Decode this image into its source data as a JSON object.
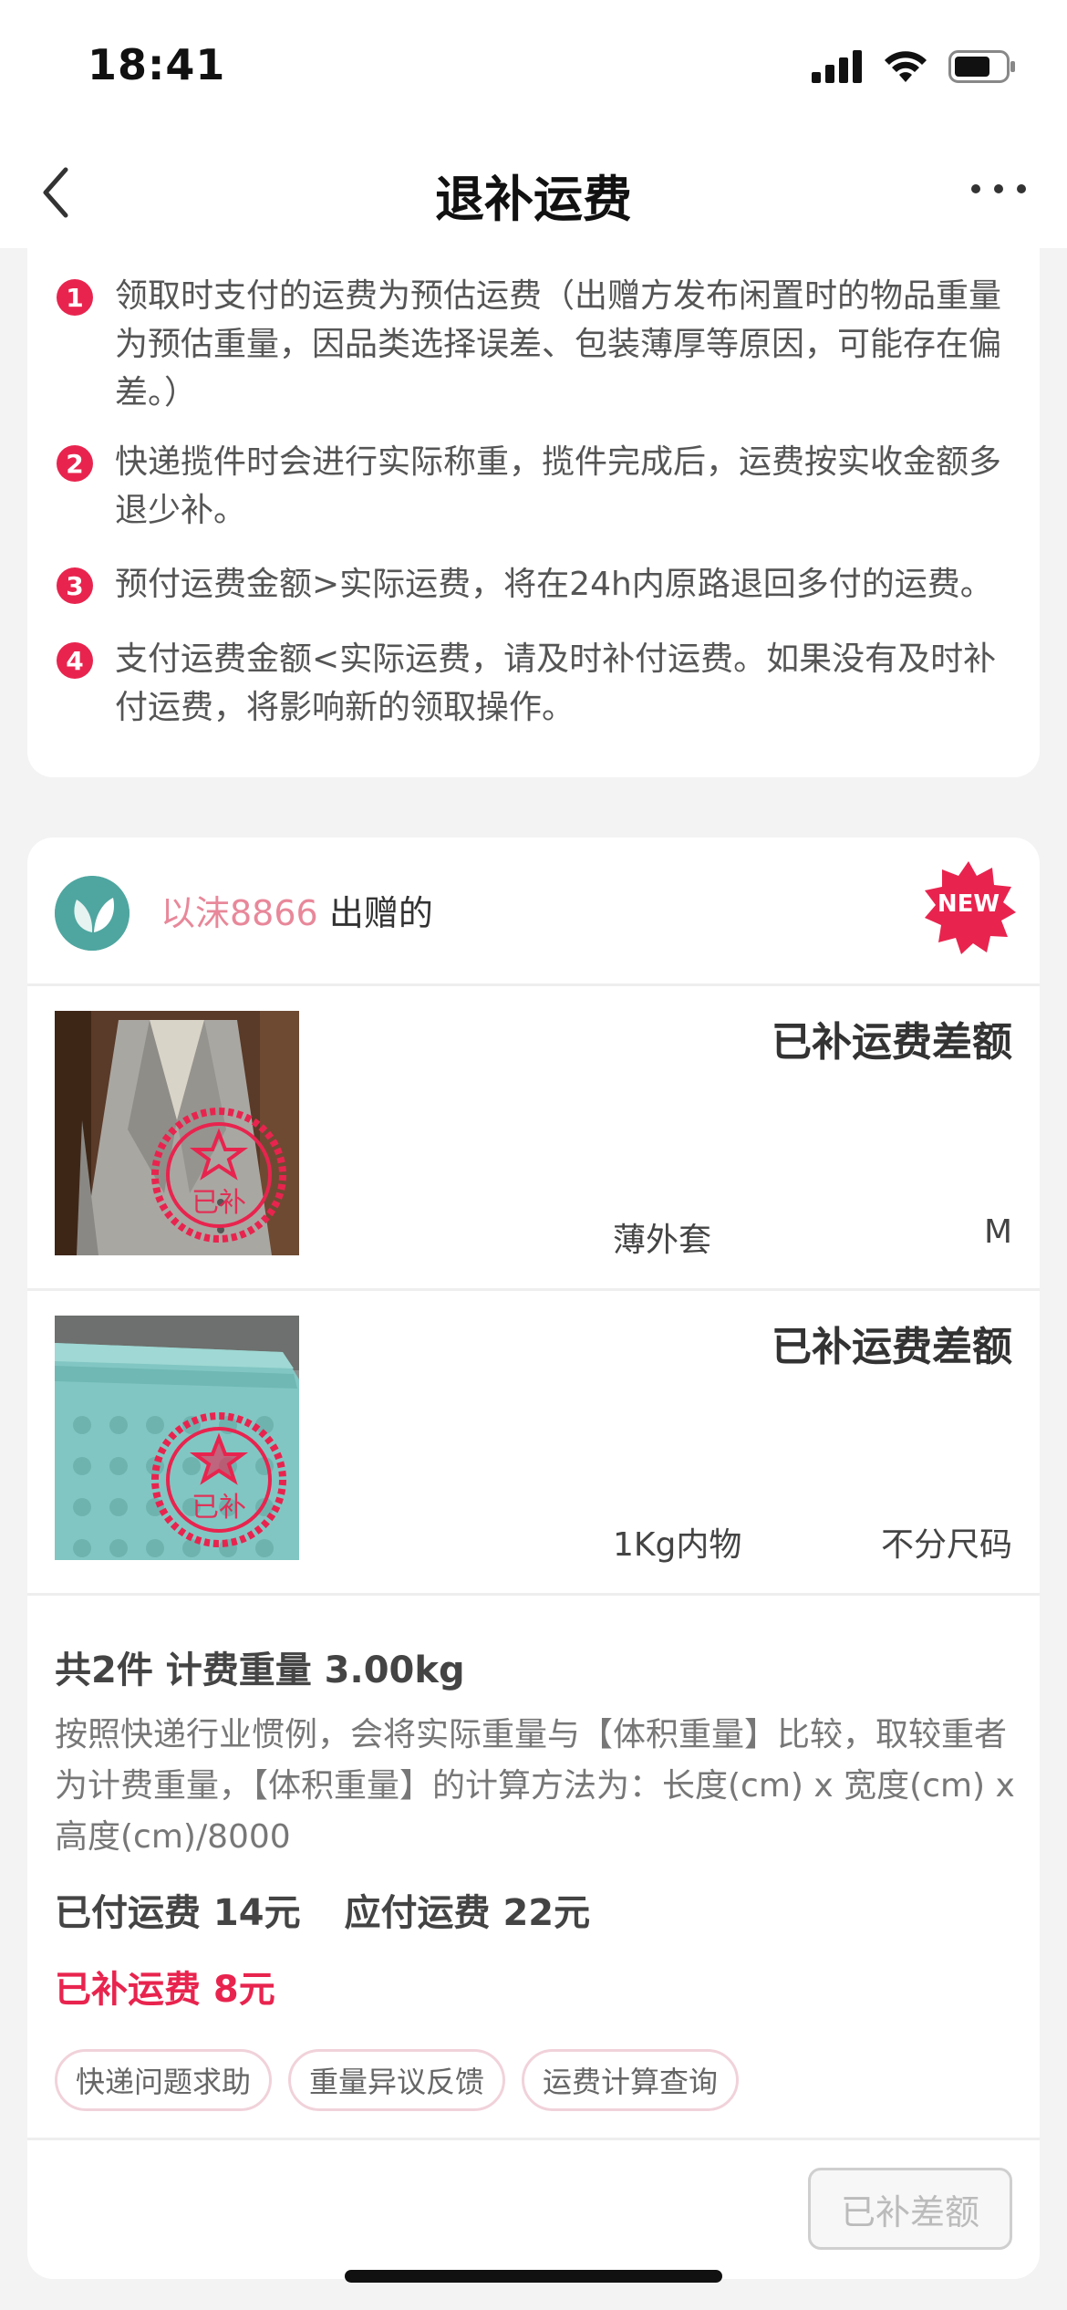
{
  "status_bar": {
    "time": "18:41"
  },
  "nav": {
    "title": "退补运费"
  },
  "rules": [
    {
      "num": "1",
      "text": "领取时支付的运费为预估运费（出赠方发布闲置时的物品重量为预估重量，因品类选择误差、包装薄厚等原因，可能存在偏差。）"
    },
    {
      "num": "2",
      "text": "快递揽件时会进行实际称重，揽件完成后，运费按实收金额多退少补。"
    },
    {
      "num": "3",
      "text": "预付运费金额>实际运费，将在24h内原路退回多付的运费。"
    },
    {
      "num": "4",
      "text": "支付运费金额<实际运费，请及时补付运费。如果没有及时补付运费，将影响新的领取操作。"
    }
  ],
  "giver": {
    "name": "以沫8866",
    "suffix": "出赠的",
    "badge": "NEW"
  },
  "items": [
    {
      "status": "已补运费差额",
      "name": "薄外套",
      "size": "M",
      "stamp": "已补"
    },
    {
      "status": "已补运费差额",
      "name": "1Kg内物",
      "size": "不分尺码",
      "stamp": "已补"
    }
  ],
  "summary": {
    "title": "共2件 计费重量 3.00kg",
    "desc": "按照快递行业惯例，会将实际重量与【体积重量】比较，取较重者为计费重量，【体积重量】的计算方法为：长度(cm) x 宽度(cm) x 高度(cm)/8000",
    "paid": "已付运费 14元",
    "due": "应付运费 22元",
    "extra": "已补运费 8元"
  },
  "tags": [
    "快递问题求助",
    "重量异议反馈",
    "运费计算查询"
  ],
  "footer": {
    "button": "已补差额"
  },
  "colors": {
    "accent": "#e8244e",
    "name_pink": "#e8889a"
  }
}
